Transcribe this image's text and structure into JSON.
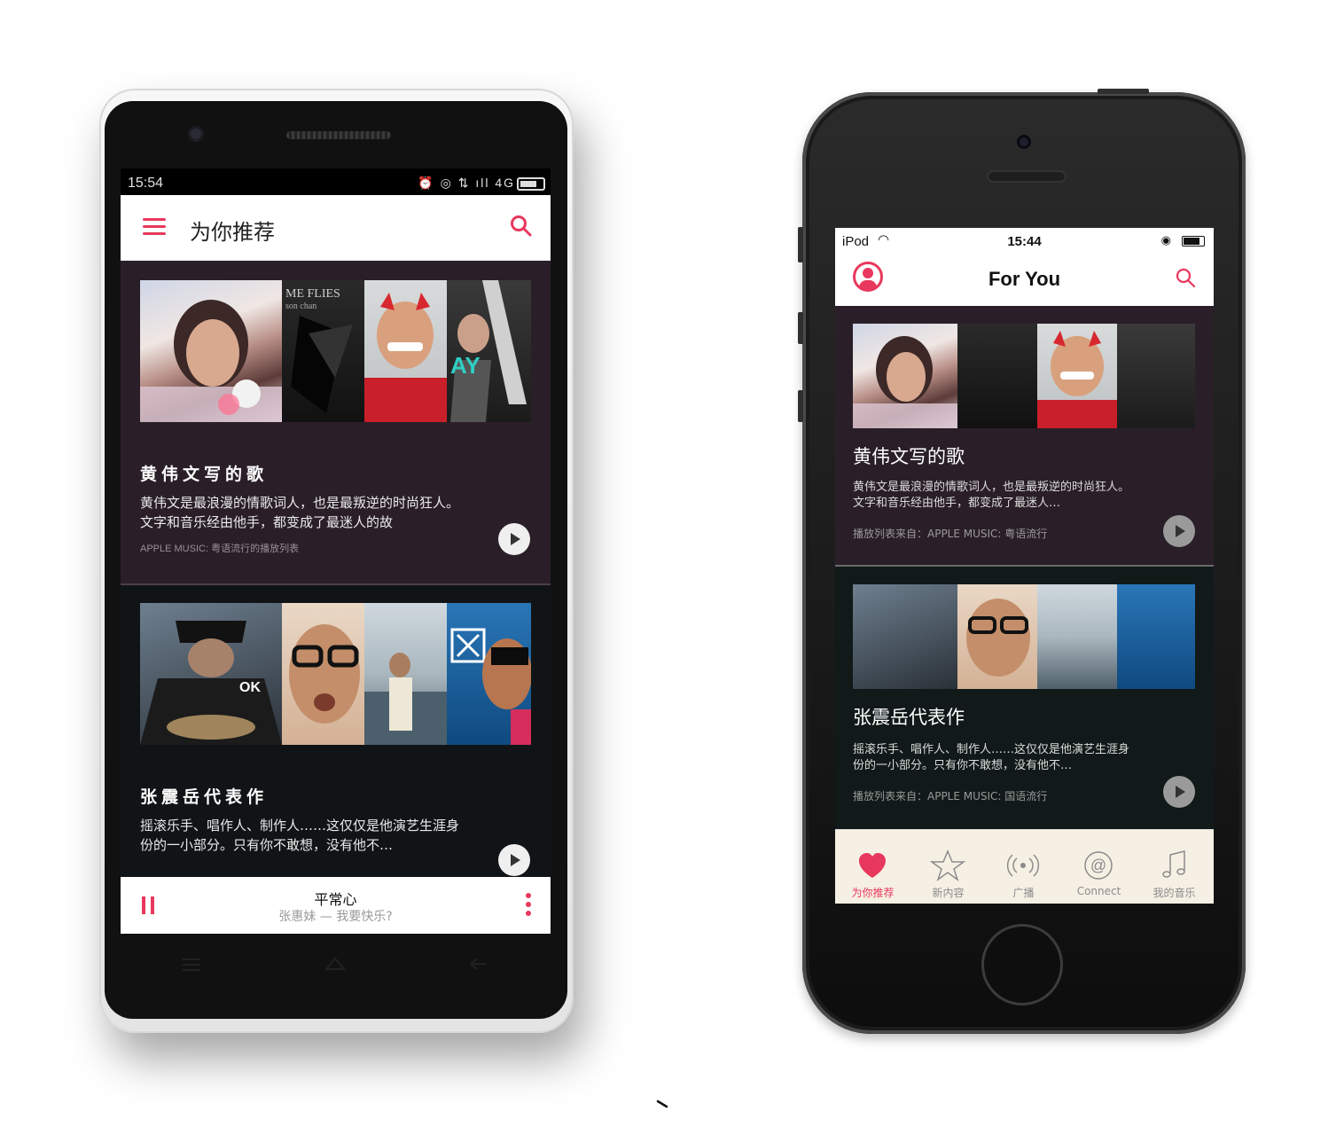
{
  "android": {
    "status": {
      "time": "15:54",
      "network": "4G"
    },
    "appbar": {
      "title": "为你推荐"
    },
    "cards": [
      {
        "title": "黄伟文写的歌",
        "description": "黄伟文是最浪漫的情歌词人，也是最叛逆的时尚狂人。文字和音乐经由他手，都变成了最迷人的故",
        "source": "APPLE MUSIC: 粤语流行的播放列表",
        "cover_text": [
          "ME FLIES",
          "son chan"
        ]
      },
      {
        "title": "张震岳代表作",
        "description": "摇滚乐手、唱作人、制作人……这仅仅是他演艺生涯身份的一小部分。只有你不敢想，没有他不…",
        "cover_text": [
          "OK"
        ]
      }
    ],
    "mini_player": {
      "song": "平常心",
      "artist": "张惠妹 — 我要快乐?"
    }
  },
  "iphone": {
    "status": {
      "carrier": "iPod",
      "time": "15:44"
    },
    "nav": {
      "title": "For You"
    },
    "cards": [
      {
        "title": "黄伟文写的歌",
        "description": "黄伟文是最浪漫的情歌词人，也是最叛逆的时尚狂人。文字和音乐经由他手，都变成了最迷人…",
        "source": "播放列表来自：APPLE MUSIC: 粤语流行"
      },
      {
        "title": "张震岳代表作",
        "description": "摇滚乐手、唱作人、制作人……这仅仅是他演艺生涯身份的一小部分。只有你不敢想，没有他不…",
        "source": "播放列表来自：APPLE MUSIC: 国语流行"
      }
    ],
    "tabs": [
      {
        "label": "为你推荐",
        "icon": "heart-icon",
        "active": true
      },
      {
        "label": "新内容",
        "icon": "star-icon",
        "active": false
      },
      {
        "label": "广播",
        "icon": "radio-icon",
        "active": false
      },
      {
        "label": "Connect",
        "icon": "at-icon",
        "active": false
      },
      {
        "label": "我的音乐",
        "icon": "music-note-icon",
        "active": false
      }
    ]
  },
  "colors": {
    "accent": "#e8385d",
    "card1_bg": "#2a1f28",
    "card2_bg": "#111416"
  }
}
